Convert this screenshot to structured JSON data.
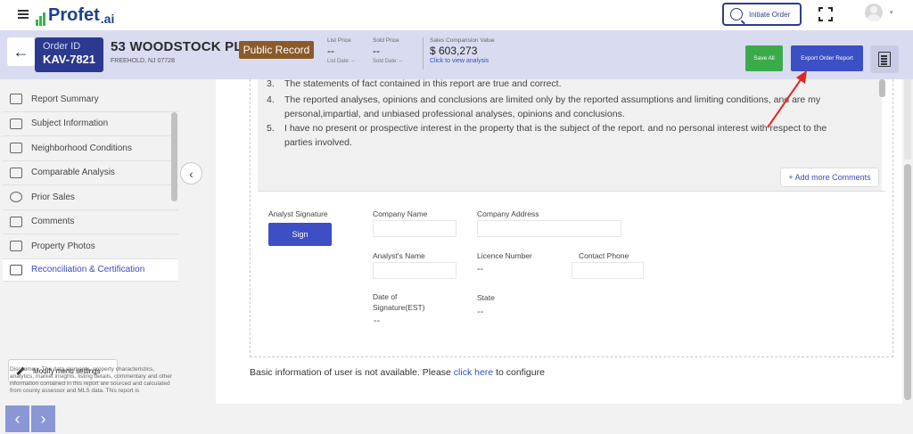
{
  "topbar": {
    "logo_text": "Profet",
    "logo_suffix": ".ai",
    "initiate_label": "Initiate Order",
    "avatar_caret": "▾"
  },
  "order": {
    "id_label": "Order ID",
    "id": "KAV-7821",
    "address": "53 WOODSTOCK PL",
    "city": "FREEHOLD, NJ 07728",
    "badge": "Public Record",
    "list_price_label": "List Price",
    "list_price": "--",
    "list_date": "List Date: --",
    "sold_price_label": "Sold Price",
    "sold_price": "--",
    "sold_date": "Sold Date: --",
    "sales_comp_label": "Sales Comparision Value",
    "sales_comp_value": "$ 603,273",
    "sales_comp_link": "Click to view analysis",
    "save_all": "Save All",
    "export": "Export Order Report",
    "back": "←"
  },
  "sidebar": {
    "items": [
      {
        "label": "Report Summary",
        "icon": "report-icon"
      },
      {
        "label": "Subject Information",
        "icon": "home-search-icon"
      },
      {
        "label": "Neighborhood Conditions",
        "icon": "neighborhood-icon"
      },
      {
        "label": "Comparable Analysis",
        "icon": "compare-icon"
      },
      {
        "label": "Prior Sales",
        "icon": "history-icon"
      },
      {
        "label": "Comments",
        "icon": "comment-icon"
      },
      {
        "label": "Property Photos",
        "icon": "photo-icon"
      },
      {
        "label": "Reconciliation & Certification",
        "icon": "certificate-icon"
      }
    ],
    "collapse": "‹",
    "modify_label": "Modify menu settings",
    "prev": "‹",
    "next": "›",
    "disclaimer": "Disclaimer : The data elements, property characteristics, analytics, market insights, listing details, commentary and other information contained in this report are sourced and calculated from county assessor and MLS data. This report is"
  },
  "content": {
    "statements": [
      {
        "num": "3.",
        "text": "The statements of fact contained in this report are true and correct."
      },
      {
        "num": "4.",
        "text": "The reported analyses, opinions and conclusions are limited only by the reported assumptions and limiting conditions, and are my personal,impartial, and unbiased professional analyses, opinions and conclusions."
      },
      {
        "num": "5.",
        "text": "I have no present or prospective interest in the property that is the subject of the report. and no personal interest with respect to the parties involved."
      }
    ],
    "add_comments": "+ Add more Comments",
    "analyst_signature": "Analyst Signature",
    "sign": "Sign",
    "company_name": "Company Name",
    "company_address": "Company Address",
    "analyst_name": "Analyst's Name",
    "licence_number": "Licence Number",
    "licence_value": "--",
    "contact_phone": "Contact Phone",
    "date_sig_line1": "Date of",
    "date_sig_line2": "Signature(EST)",
    "date_sig_value": "--",
    "state": "State",
    "state_value": "--",
    "info_prefix": "Basic information of user is not available. Please ",
    "info_link": "click here",
    "info_suffix": " to configure"
  },
  "colors": {
    "brand_navy": "#2b3990",
    "accent_blue": "#3c4fc4",
    "save_green": "#3bab4a",
    "badge_brown": "#8a5a2a",
    "header_bg": "#d9dcf0",
    "annotation_red": "#e0261f"
  }
}
